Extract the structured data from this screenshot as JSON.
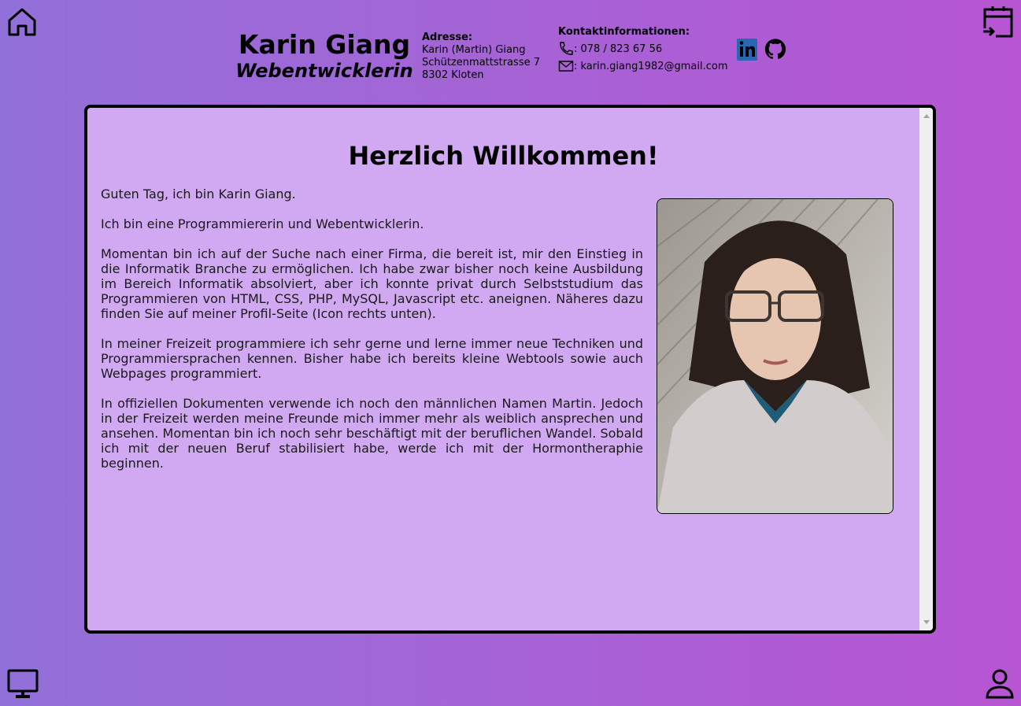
{
  "nav": {
    "home_icon": "home-icon",
    "calendar_icon": "calendar-arrow-icon",
    "monitor_icon": "monitor-icon",
    "user_icon": "user-icon"
  },
  "header": {
    "name": "Karin Giang",
    "role": "Webentwicklerin",
    "address": {
      "label": "Adresse:",
      "line1": "Karin (Martin) Giang",
      "line2": "Schützenmattstrasse 7",
      "line3": "8302 Kloten"
    },
    "contact": {
      "label": "Kontaktinformationen:",
      "phone": ": 078 / 823 67 56",
      "email": ": karin.giang1982@gmail.com"
    },
    "socials": [
      "linkedin-icon",
      "github-icon"
    ]
  },
  "main": {
    "title": "Herzlich Willkommen!",
    "paragraphs": [
      "Guten Tag, ich bin Karin Giang.",
      "Ich bin eine Programmiererin und Webentwicklerin.",
      "Momentan bin ich auf der Suche nach einer Firma, die bereit ist, mir den Einstieg in die Informatik Branche zu ermöglichen. Ich habe zwar bisher noch keine Ausbildung im Bereich Informatik absolviert, aber ich konnte privat durch Selbststudium das Programmieren von HTML, CSS, PHP, MySQL, Javascript etc. aneignen. Näheres dazu finden Sie auf meiner Profil-Seite (Icon rechts unten).",
      "In meiner Freizeit programmiere ich sehr gerne und lerne immer neue Techniken und Programmiersprachen kennen. Bisher habe ich bereits kleine Webtools sowie auch Webpages programmiert.",
      "In offiziellen Dokumenten verwende ich noch den männlichen Namen Martin. Jedoch in der Freizeit werden meine Freunde mich immer mehr als weiblich ansprechen und ansehen. Momentan bin ich noch sehr beschäftigt mit der beruflichen Wandel. Sobald ich mit der neuen Beruf stabilisiert habe, werde ich mit der Hormontheraphie beginnen."
    ]
  },
  "colors": {
    "gradient_start": "#9270d9",
    "gradient_end": "#b755d3",
    "panel_bg": "#d1a9f2",
    "linkedin": "#2867b2"
  }
}
